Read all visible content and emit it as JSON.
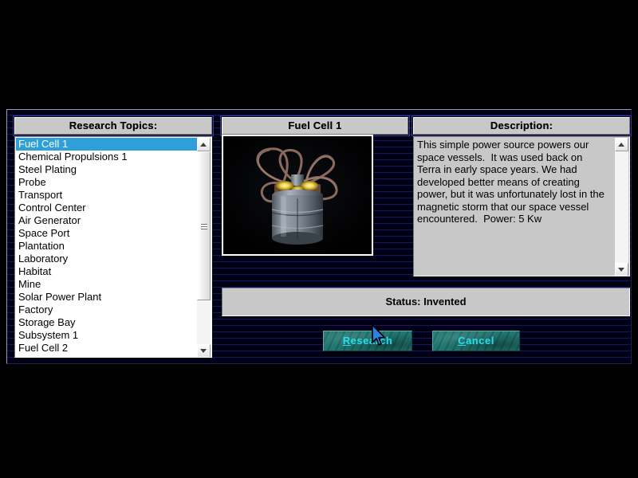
{
  "dialog": {
    "panels": {
      "topics_header": "Research Topics:",
      "image_header": "Fuel Cell 1",
      "description_header": "Description:"
    },
    "topics": [
      {
        "label": "Fuel Cell 1",
        "selected": true
      },
      {
        "label": "Chemical Propulsions 1",
        "selected": false
      },
      {
        "label": "Steel Plating",
        "selected": false
      },
      {
        "label": "Probe",
        "selected": false
      },
      {
        "label": "Transport",
        "selected": false
      },
      {
        "label": "Control Center",
        "selected": false
      },
      {
        "label": "Air Generator",
        "selected": false
      },
      {
        "label": "Space Port",
        "selected": false
      },
      {
        "label": "Plantation",
        "selected": false
      },
      {
        "label": "Laboratory",
        "selected": false
      },
      {
        "label": "Habitat",
        "selected": false
      },
      {
        "label": "Mine",
        "selected": false
      },
      {
        "label": "Solar Power Plant",
        "selected": false
      },
      {
        "label": "Factory",
        "selected": false
      },
      {
        "label": "Storage Bay",
        "selected": false
      },
      {
        "label": "Subsystem 1",
        "selected": false
      },
      {
        "label": "Fuel Cell 2",
        "selected": false
      }
    ],
    "description_text": "This simple power source powers our space vessels.  It was used back on Terra in early space years. We had developed better means of creating power, but it was unfortunately lost in the magnetic storm that our space vessel encountered.  Power: 5 Kw",
    "status": "Status: Invented",
    "buttons": {
      "research": {
        "accel": "R",
        "rest": "esearch"
      },
      "cancel": {
        "accel": "C",
        "rest": "ancel"
      }
    },
    "artwork_name": "fuel-cell-render",
    "colors": {
      "selection_blue": "#2f9fda",
      "button_teal": "#1f716c",
      "button_text_cyan": "#25e0ee",
      "panel_gray": "#c8c8c8",
      "background_line_blue": "#161670"
    },
    "icons": {
      "scroll_up": "triangle-up-icon",
      "scroll_down": "triangle-down-icon",
      "cursor": "mouse-pointer-icon"
    }
  }
}
